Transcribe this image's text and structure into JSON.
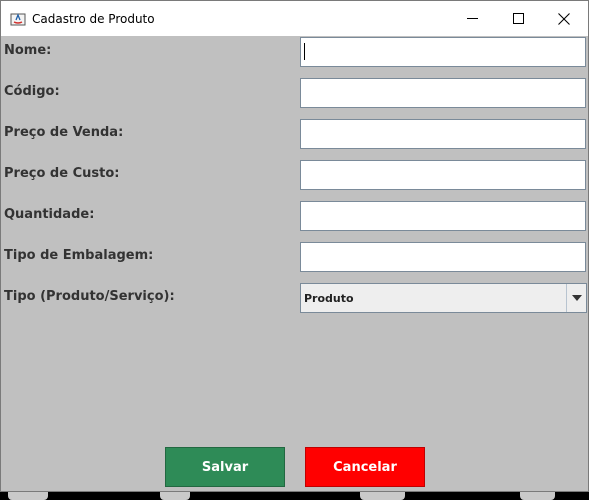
{
  "window": {
    "title": "Cadastro de Produto",
    "controls": {
      "minimize": "minimize",
      "maximize": "maximize",
      "close": "close"
    }
  },
  "form": {
    "fields": [
      {
        "label": "Nome:",
        "value": ""
      },
      {
        "label": "Código:",
        "value": ""
      },
      {
        "label": "Preço de Venda:",
        "value": ""
      },
      {
        "label": "Preço de Custo:",
        "value": ""
      },
      {
        "label": "Quantidade:",
        "value": ""
      },
      {
        "label": "Tipo de Embalagem:",
        "value": ""
      }
    ],
    "type_select": {
      "label": "Tipo (Produto/Serviço):",
      "selected": "Produto"
    }
  },
  "buttons": {
    "save": "Salvar",
    "cancel": "Cancelar"
  },
  "colors": {
    "background": "#c0c0c0",
    "save": "#2e8b57",
    "cancel": "#ff0000"
  }
}
